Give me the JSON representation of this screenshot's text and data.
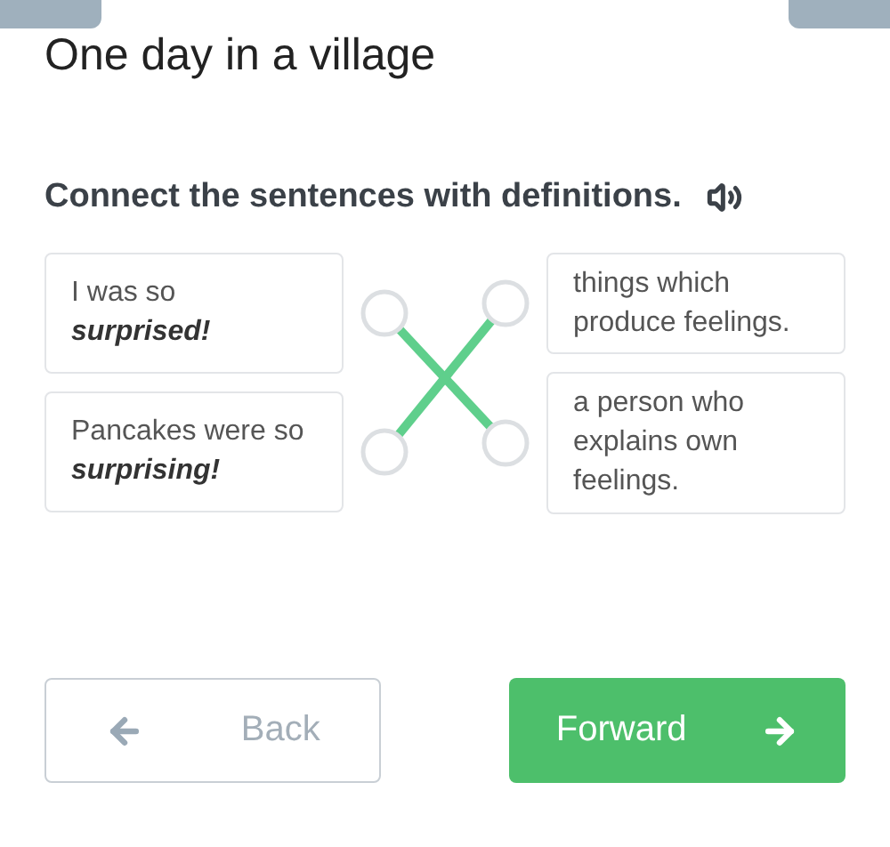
{
  "title": "One day in a village",
  "instruction": "Connect the sentences with definitions.",
  "left_items": [
    {
      "text": "I was so **surprised!**",
      "linked_down": true
    },
    {
      "text": "Pancakes were so **surprising!**",
      "linked_down": false
    }
  ],
  "right_items": [
    {
      "text": "things which produce feelings."
    },
    {
      "text": "a person who explains own feelings."
    }
  ],
  "buttons": [
    {
      "kind": "back",
      "label": "Back"
    },
    {
      "kind": "forward",
      "label": "Forward"
    }
  ]
}
